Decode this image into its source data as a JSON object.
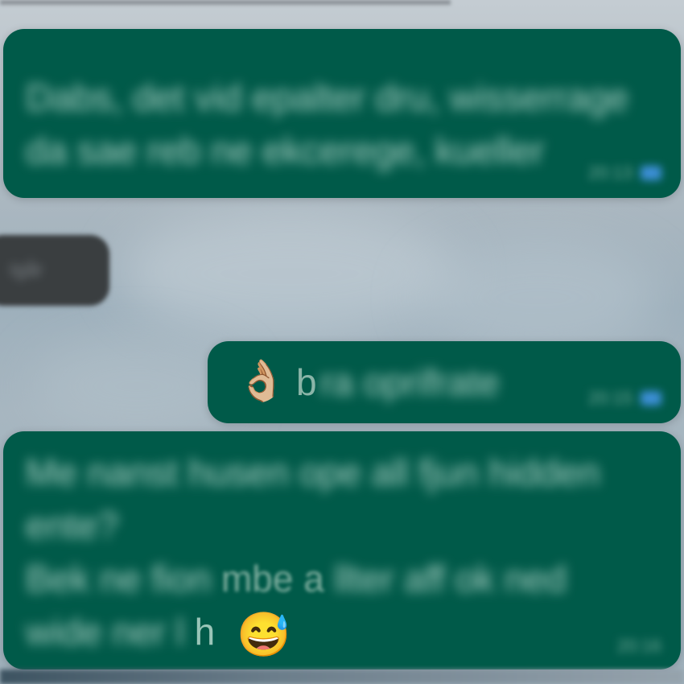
{
  "messages": [
    {
      "id": "msg1",
      "lines": [
        "Dabs, det vid epalter dru, wisserrage",
        "da sae reb ne ekcerege, kueller"
      ],
      "time": "20:13"
    },
    {
      "id": "date",
      "label": "Igår"
    },
    {
      "id": "msg2",
      "emoji": "👌🏼",
      "text_clear": "b",
      "text_blur": "ra oprifrate",
      "time": "20:15"
    },
    {
      "id": "msg3",
      "lines": [
        "Me nanst husen ope all fjun hidden",
        "ente?"
      ],
      "line3_blur_a": "Bek ne fion",
      "line3_clear": "mbe a",
      "line3_blur_b": "llter aff ok ned",
      "line4_blur": "wide ner l",
      "line4_clear": "h",
      "emoji": "😅",
      "time": "20:16"
    }
  ],
  "colors": {
    "bubble": "#005a49",
    "read_ticks": "#3c8fd6"
  }
}
